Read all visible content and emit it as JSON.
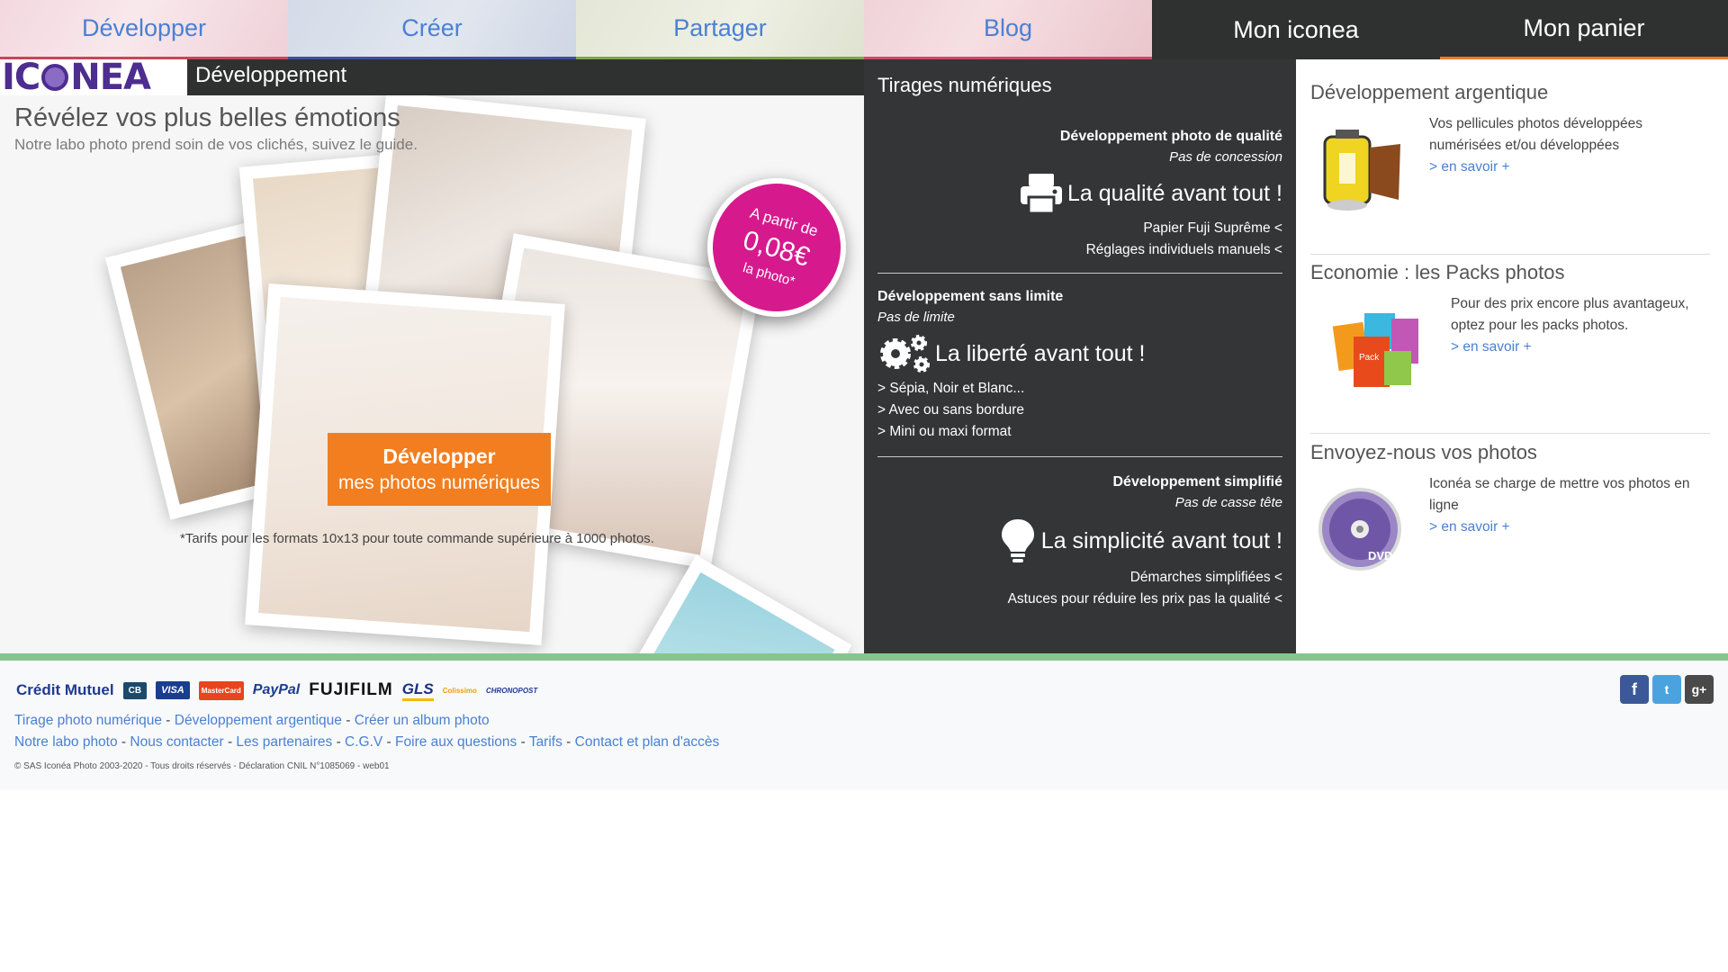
{
  "nav": {
    "items": [
      {
        "label": "Développer"
      },
      {
        "label": "Créer"
      },
      {
        "label": "Partager"
      },
      {
        "label": "Blog"
      },
      {
        "label": "Mon iconea"
      },
      {
        "label": "Mon panier"
      }
    ]
  },
  "brand": {
    "logo_text": "ICONEA",
    "section": "Développement"
  },
  "hero": {
    "title": "Révélez vos plus belles émotions",
    "subtitle": "Notre labo photo prend soin de vos clichés, suivez le guide.",
    "badge": {
      "line1": "A partir de",
      "price": "0,08€",
      "line3": "la photo*"
    },
    "cta": {
      "line1": "Développer",
      "line2": "mes photos numériques"
    },
    "note": "*Tarifs pour les formats 10x13 pour toute commande supérieure à 1000 photos."
  },
  "middle": {
    "title": "Tirages numériques",
    "features": [
      {
        "heading": "Développement photo de qualité",
        "sub": "Pas de concession",
        "big": "La qualité avant tout !",
        "icon": "printer-icon",
        "items": [
          "Papier Fuji Suprême <",
          "Réglages individuels manuels <"
        ]
      },
      {
        "heading": "Développement sans limite",
        "sub": "Pas de limite",
        "big": "La liberté avant tout !",
        "icon": "gears-icon",
        "items": [
          "> Sépia, Noir et Blanc...",
          "> Avec ou sans bordure",
          "> Mini ou maxi format"
        ]
      },
      {
        "heading": "Développement simplifié",
        "sub": "Pas de casse tête",
        "big": "La simplicité avant tout !",
        "icon": "lightbulb-icon",
        "items": [
          "Démarches simplifiées <",
          "Astuces pour réduire les prix pas la qualité <"
        ]
      }
    ]
  },
  "side": {
    "cards": [
      {
        "title": "Développement argentique",
        "desc": "Vos pellicules photos développées numérisées et/ou développées",
        "more": "> en savoir +",
        "icon": "film-roll-icon"
      },
      {
        "title": "Economie : les Packs photos",
        "desc": "Pour des prix encore plus avantageux, optez pour les packs photos.",
        "more": "> en savoir +",
        "icon": "photo-packs-icon"
      },
      {
        "title": "Envoyez-nous vos photos",
        "desc": "Iconéa se charge de mettre vos photos en ligne",
        "more": "> en savoir +",
        "icon": "dvd-icon"
      }
    ]
  },
  "footer": {
    "partners": [
      "Crédit Mutuel",
      "CB",
      "VISA",
      "MasterCard",
      "PayPal",
      "FUJIFILM",
      "GLS",
      "Colissimo",
      "CHRONOPOST"
    ],
    "links_row1": [
      "Tirage photo numérique",
      "Développement argentique",
      "Créer un album photo"
    ],
    "links_row2": [
      "Notre labo photo",
      "Nous contacter",
      "Les partenaires",
      "C.G.V",
      "Foire aux questions",
      "Tarifs",
      "Contact et plan d'accès"
    ],
    "copyright": "© SAS Iconéa Photo 2003-2020 - Tous droits réservés - Déclaration CNIL N°1085069 - web01",
    "social": [
      "facebook-icon",
      "twitter-icon",
      "google-plus-icon"
    ]
  },
  "colors": {
    "accent_orange": "#f27e1f",
    "badge_pink": "#d7198e",
    "dark": "#333537",
    "link": "#4a80d4",
    "brand_purple": "#4d2d8f"
  }
}
